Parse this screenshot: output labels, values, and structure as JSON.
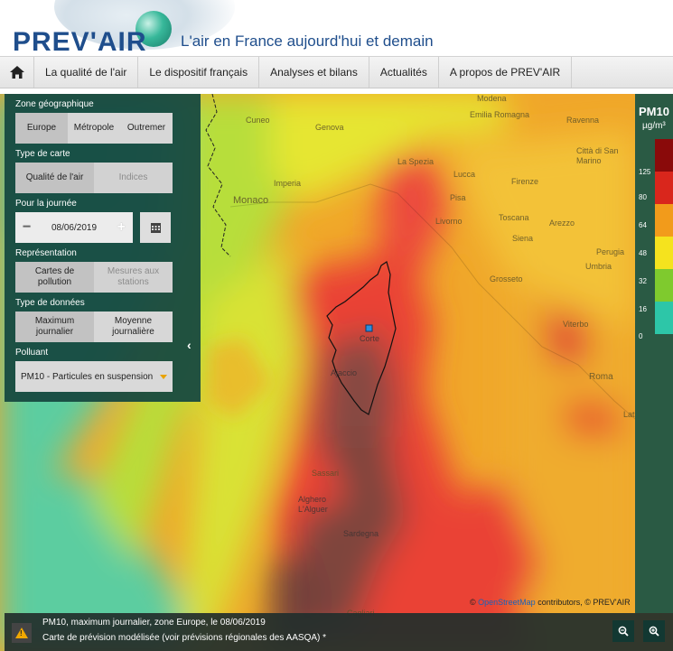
{
  "header": {
    "logo": "PREV'AIR",
    "tagline": "L'air en France aujourd'hui et demain"
  },
  "nav": {
    "items": [
      "La qualité de l'air",
      "Le dispositif français",
      "Analyses et bilans",
      "Actualités",
      "A propos de PREV'AIR"
    ]
  },
  "panel": {
    "zone_label": "Zone géographique",
    "zone_options": [
      "Europe",
      "Métropole",
      "Outremer"
    ],
    "type_carte_label": "Type de carte",
    "type_carte_options": [
      "Qualité de l'air",
      "Indices"
    ],
    "journee_label": "Pour la journée",
    "date_value": "08/06/2019",
    "representation_label": "Représentation",
    "representation_options": [
      "Cartes de pollution",
      "Mesures aux stations"
    ],
    "type_donnees_label": "Type de données",
    "type_donnees_options": [
      "Maximum journalier",
      "Moyenne journalière"
    ],
    "polluant_label": "Polluant",
    "polluant_value": "PM10 - Particules en suspension"
  },
  "legend": {
    "title": "PM10",
    "unit": "µg/m³",
    "thresholds": [
      "125",
      "80",
      "64",
      "48",
      "32",
      "16",
      "0"
    ],
    "colors": [
      "#8a0a0a",
      "#d9261c",
      "#f29b1b",
      "#f5e31e",
      "#7fca2e",
      "#2dc6a8"
    ]
  },
  "map": {
    "places": [
      "Genova",
      "Modena",
      "Emilia Romagna",
      "Ravenna",
      "Cuneo",
      "Città di San Marino",
      "La Spezia",
      "Imperia",
      "Monaco",
      "Lucca",
      "Firenze",
      "Pisa",
      "Livorno",
      "Toscana",
      "Arezzo",
      "Siena",
      "Perugia",
      "Umbria",
      "Grosseto",
      "Viterbo",
      "Roma",
      "Latina",
      "Corte",
      "Ajaccio",
      "Sassari",
      "Alghero",
      "L'Alguer",
      "Sardegna",
      "Cagliari"
    ]
  },
  "attribution": {
    "prefix": "© ",
    "osm": "OpenStreetMap",
    "suffix": " contributors, © PREV'AIR"
  },
  "bottom": {
    "line1": "PM10, maximum journalier, zone Europe, le 08/06/2019",
    "line2": "Carte de prévision modélisée (voir prévisions régionales des AASQA) *"
  }
}
